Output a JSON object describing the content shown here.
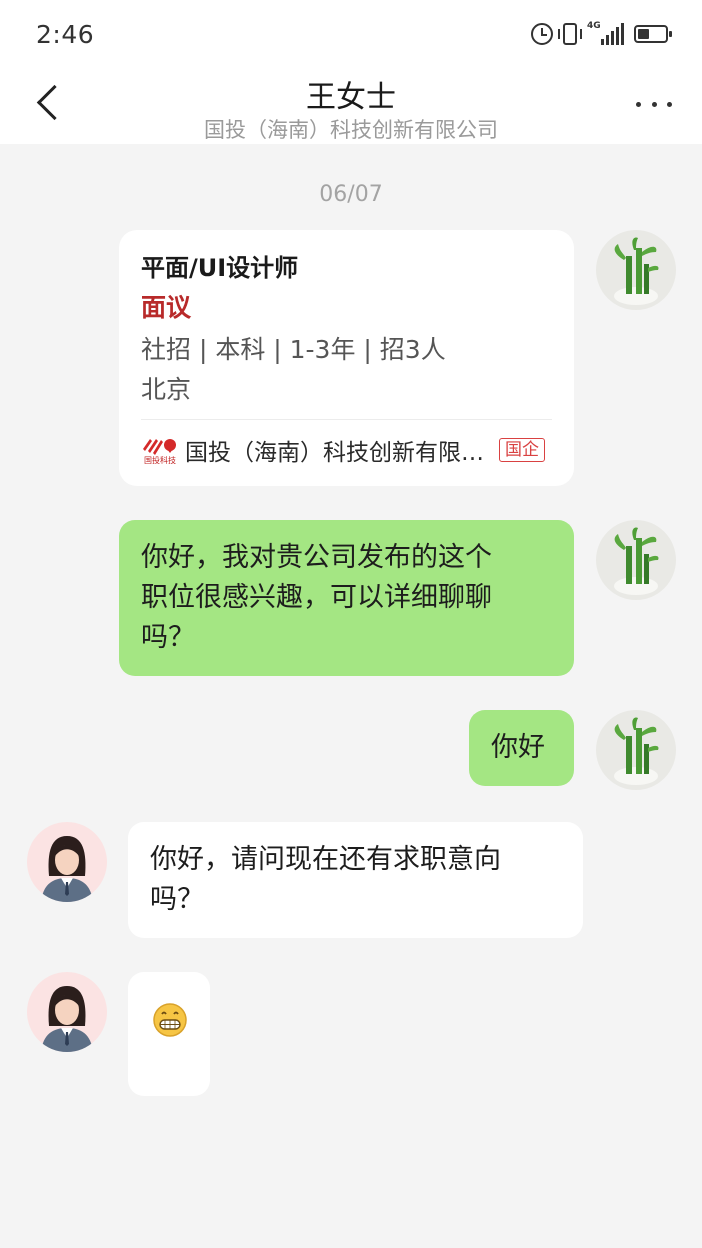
{
  "status_bar": {
    "time": "2:46",
    "network": "4G"
  },
  "header": {
    "title": "王女士",
    "subtitle": "国投（海南）科技创新有限公司"
  },
  "chat": {
    "date": "06/07",
    "job_card": {
      "title": "平面/UI设计师",
      "salary": "面议",
      "requirements": "社招 | 本科 | 1-3年 | 招3人",
      "location": "北京",
      "company": "国投（海南）科技创新有限公司",
      "company_tag": "国企",
      "logo_text": "国投科技"
    },
    "messages": [
      {
        "from": "me",
        "line1": "你好，我对贵公司发布的这个",
        "line2": "职位很感兴趣，可以详细聊聊",
        "line3": "吗？"
      },
      {
        "from": "me",
        "text": "你好"
      },
      {
        "from": "recruiter",
        "line1": "你好，请问现在还有求职意向",
        "line2": "吗？"
      },
      {
        "from": "recruiter",
        "emoji": "grinning-face-emoji"
      }
    ]
  },
  "colors": {
    "my_bubble": "#a4e683",
    "their_bubble": "#ffffff",
    "background": "#f4f4f4",
    "salary": "#b82a2a",
    "tag": "#d94141"
  }
}
